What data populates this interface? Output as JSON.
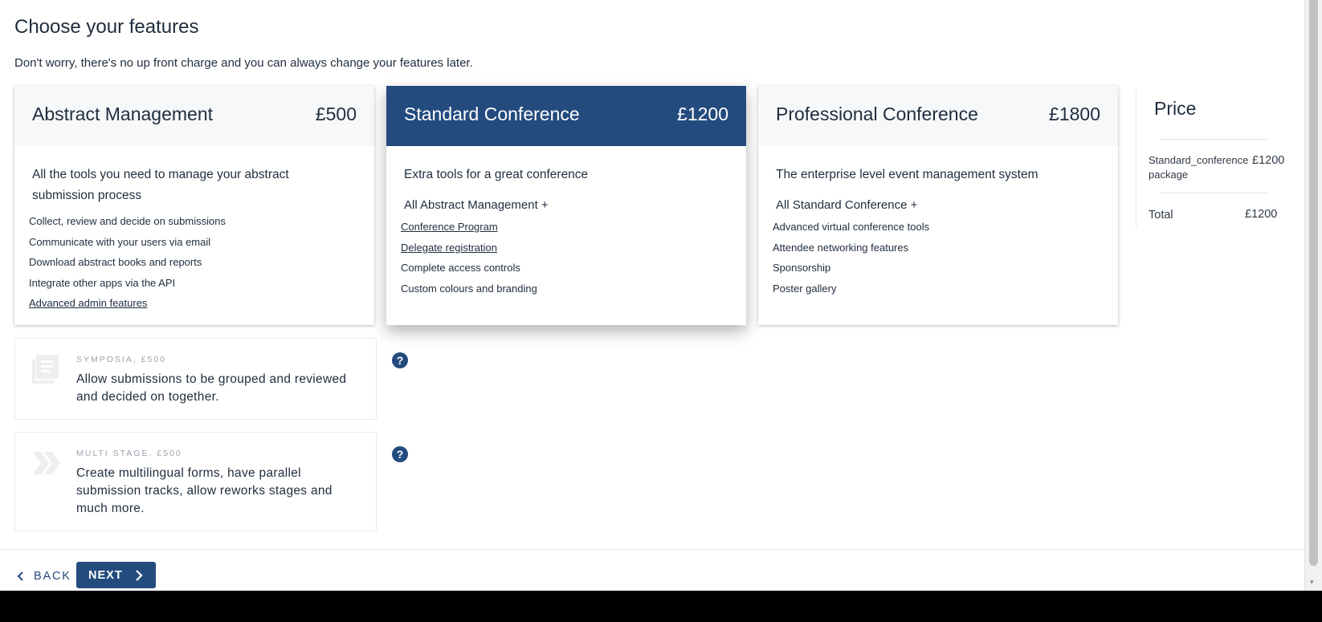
{
  "page": {
    "title": "Choose your features",
    "subtitle": "Don't worry, there's no up front charge and you can always change your features later."
  },
  "plans": [
    {
      "name": "Abstract Management",
      "price": "£500",
      "description": "All the tools you need to manage your abstract submission process",
      "features": [
        "Collect, review and decide on submissions",
        "Communicate with your users via email",
        "Download abstract books and reports",
        "Integrate other apps via the API",
        "Advanced admin features"
      ]
    },
    {
      "name": "Standard Conference",
      "price": "£1200",
      "description": "Extra tools for a great conference",
      "includes": "All Abstract Management +",
      "features": [
        "Conference Program",
        "Delegate registration",
        "Complete access controls",
        "Custom colours and branding"
      ]
    },
    {
      "name": "Professional Conference",
      "price": "£1800",
      "description": "The enterprise level event management system",
      "includes": "All Standard Conference +",
      "features": [
        "Advanced virtual conference tools",
        "Attendee networking features",
        "Sponsorship",
        "Poster gallery"
      ]
    }
  ],
  "addons": [
    {
      "kicker": "SYMPOSIA, £500",
      "text": "Allow submissions to be grouped and reviewed and decided on together.",
      "icon": "list-document-icon"
    },
    {
      "kicker": "MULTI STAGE, £500",
      "text": "Create multilingual forms, have parallel submission tracks, allow reworks stages and much more.",
      "icon": "double-chevron-icon"
    }
  ],
  "help_icon": "?",
  "price_panel": {
    "title": "Price",
    "item": "Standard_conference package",
    "item_price": "£1200",
    "total_label": "Total",
    "total_price": "£1200"
  },
  "nav": {
    "back_label": "BACK",
    "next_label": "NEXT"
  },
  "colors": {
    "primary": "#244b7e",
    "text": "#1f2d3d",
    "muted": "#9aa3ad",
    "card_header": "#f6f8fa"
  }
}
